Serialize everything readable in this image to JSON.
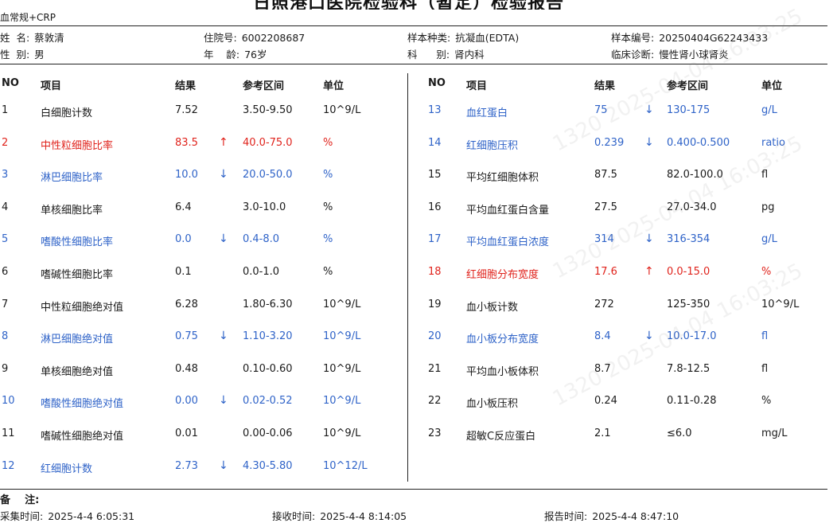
{
  "report": {
    "title": "日照港口医院检验科（暂定）检验报告",
    "panel": "血常规+CRP"
  },
  "patient": {
    "name_label": "姓  名:",
    "name": "蔡敦清",
    "gender_label": "性  别:",
    "gender": "男",
    "inpatient_label": "住院号:",
    "inpatient": "6002208687",
    "age_label": "年    龄:",
    "age": "76岁",
    "sample_type_label": "样本种类:",
    "sample_type": "抗凝血(EDTA)",
    "dept_label": "科      别:",
    "dept": "肾内科",
    "sample_no_label": "样本编号:",
    "sample_no": "20250404G62243433",
    "diagnosis_label": "临床诊断:",
    "diagnosis": "慢性肾小球肾炎"
  },
  "headers": {
    "no": "NO",
    "item": "项目",
    "result": "结果",
    "range": "参考区间",
    "unit": "单位"
  },
  "left_rows": [
    {
      "no": "1",
      "item": "白细胞计数",
      "result": "7.52",
      "flag": "",
      "range": "3.50-9.50",
      "unit": "10^9/L",
      "status": "normal"
    },
    {
      "no": "2",
      "item": "中性粒细胞比率",
      "result": "83.5",
      "flag": "↑",
      "range": "40.0-75.0",
      "unit": "%",
      "status": "high"
    },
    {
      "no": "3",
      "item": "淋巴细胞比率",
      "result": "10.0",
      "flag": "↓",
      "range": "20.0-50.0",
      "unit": "%",
      "status": "low"
    },
    {
      "no": "4",
      "item": "单核细胞比率",
      "result": "6.4",
      "flag": "",
      "range": "3.0-10.0",
      "unit": "%",
      "status": "normal"
    },
    {
      "no": "5",
      "item": "嗜酸性细胞比率",
      "result": "0.0",
      "flag": "↓",
      "range": "0.4-8.0",
      "unit": "%",
      "status": "low"
    },
    {
      "no": "6",
      "item": "嗜碱性细胞比率",
      "result": "0.1",
      "flag": "",
      "range": "0.0-1.0",
      "unit": "%",
      "status": "normal"
    },
    {
      "no": "7",
      "item": "中性粒细胞绝对值",
      "result": "6.28",
      "flag": "",
      "range": "1.80-6.30",
      "unit": "10^9/L",
      "status": "normal"
    },
    {
      "no": "8",
      "item": "淋巴细胞绝对值",
      "result": "0.75",
      "flag": "↓",
      "range": "1.10-3.20",
      "unit": "10^9/L",
      "status": "low"
    },
    {
      "no": "9",
      "item": "单核细胞绝对值",
      "result": "0.48",
      "flag": "",
      "range": "0.10-0.60",
      "unit": "10^9/L",
      "status": "normal"
    },
    {
      "no": "10",
      "item": "嗜酸性细胞绝对值",
      "result": "0.00",
      "flag": "↓",
      "range": "0.02-0.52",
      "unit": "10^9/L",
      "status": "low"
    },
    {
      "no": "11",
      "item": "嗜碱性细胞绝对值",
      "result": "0.01",
      "flag": "",
      "range": "0.00-0.06",
      "unit": "10^9/L",
      "status": "normal"
    },
    {
      "no": "12",
      "item": "红细胞计数",
      "result": "2.73",
      "flag": "↓",
      "range": "4.30-5.80",
      "unit": "10^12/L",
      "status": "low"
    }
  ],
  "right_rows": [
    {
      "no": "13",
      "item": "血红蛋白",
      "result": "75",
      "flag": "↓",
      "range": "130-175",
      "unit": "g/L",
      "status": "low"
    },
    {
      "no": "14",
      "item": "红细胞压积",
      "result": "0.239",
      "flag": "↓",
      "range": "0.400-0.500",
      "unit": "ratio",
      "status": "low"
    },
    {
      "no": "15",
      "item": "平均红细胞体积",
      "result": "87.5",
      "flag": "",
      "range": "82.0-100.0",
      "unit": "fl",
      "status": "normal"
    },
    {
      "no": "16",
      "item": "平均血红蛋白含量",
      "result": "27.5",
      "flag": "",
      "range": "27.0-34.0",
      "unit": "pg",
      "status": "normal"
    },
    {
      "no": "17",
      "item": "平均血红蛋白浓度",
      "result": "314",
      "flag": "↓",
      "range": "316-354",
      "unit": "g/L",
      "status": "low"
    },
    {
      "no": "18",
      "item": "红细胞分布宽度",
      "result": "17.6",
      "flag": "↑",
      "range": "0.0-15.0",
      "unit": "%",
      "status": "high"
    },
    {
      "no": "19",
      "item": "血小板计数",
      "result": "272",
      "flag": "",
      "range": "125-350",
      "unit": "10^9/L",
      "status": "normal"
    },
    {
      "no": "20",
      "item": "血小板分布宽度",
      "result": "8.4",
      "flag": "↓",
      "range": "10.0-17.0",
      "unit": "fl",
      "status": "low"
    },
    {
      "no": "21",
      "item": "平均血小板体积",
      "result": "8.7",
      "flag": "",
      "range": "7.8-12.5",
      "unit": "fl",
      "status": "normal"
    },
    {
      "no": "22",
      "item": "血小板压积",
      "result": "0.24",
      "flag": "",
      "range": "0.11-0.28",
      "unit": "%",
      "status": "normal"
    },
    {
      "no": "23",
      "item": "超敏C反应蛋白",
      "result": "2.1",
      "flag": "",
      "range": "≤6.0",
      "unit": "mg/L",
      "status": "normal"
    }
  ],
  "footer": {
    "remark_label": "备    注:",
    "collect_label": "采集时间:",
    "collect_time": "2025-4-4 6:05:31",
    "receive_label": "接收时间:",
    "receive_time": "2025-4-4 8:14:05",
    "report_label": "报告时间:",
    "report_time": "2025-4-4 8:47:10"
  },
  "watermark": "1320 2025-04-04 16:03:25",
  "colors": {
    "low": "#2f63c8",
    "high": "#e0231c",
    "normal": "#1a1a1a"
  }
}
